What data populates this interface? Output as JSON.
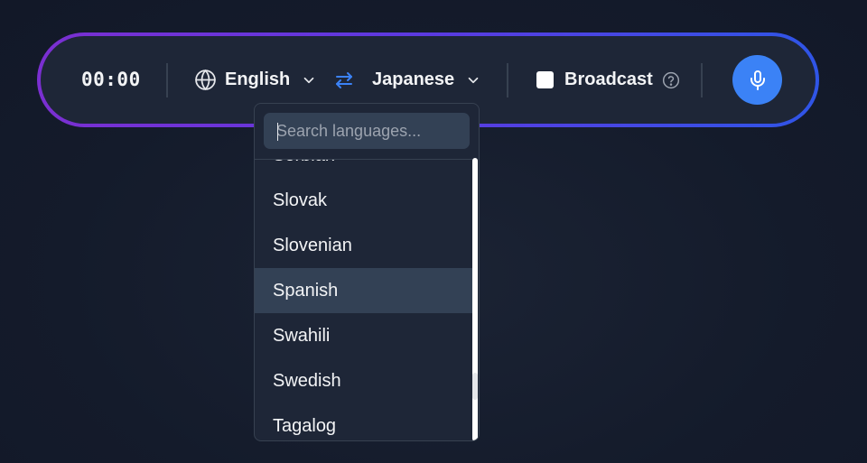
{
  "toolbar": {
    "timer": "00:00",
    "source_language": "English",
    "target_language": "Japanese",
    "broadcast_label": "Broadcast",
    "broadcast_checked": false
  },
  "icons": {
    "source": "globe-icon",
    "dropdown": "chevron-down-icon",
    "swap": "swap-arrows-icon",
    "help": "help-circle-icon",
    "mic": "microphone-icon"
  },
  "colors": {
    "accent": "#3b82f6",
    "gradient_start": "#7b2fd1",
    "gradient_end": "#2f55e6",
    "panel_bg": "#1e2637",
    "highlight": "#334155"
  },
  "dropdown": {
    "search_placeholder": "Search languages...",
    "search_value": "",
    "items": [
      "Serbian",
      "Slovak",
      "Slovenian",
      "Spanish",
      "Swahili",
      "Swedish",
      "Tagalog"
    ],
    "highlighted_item": "Spanish"
  }
}
